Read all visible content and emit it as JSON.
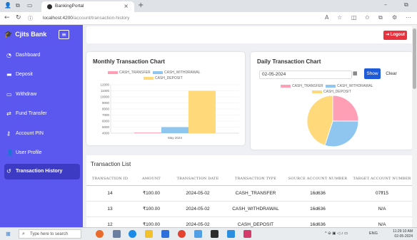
{
  "browser": {
    "tab_title": "BankingPortal",
    "url_host": "localhost:4200",
    "url_path": "/account/transaction-history"
  },
  "sidebar": {
    "brand": "Cjits Bank",
    "items": [
      {
        "label": "Dashboard",
        "icon": "speedometer-icon"
      },
      {
        "label": "Deposit",
        "icon": "cash-icon"
      },
      {
        "label": "Withdraw",
        "icon": "money-icon"
      },
      {
        "label": "Fund Transfer",
        "icon": "transfer-icon"
      },
      {
        "label": "Account PIN",
        "icon": "key-icon"
      },
      {
        "label": "User Profile",
        "icon": "user-icon"
      },
      {
        "label": "Transaction History",
        "icon": "history-icon",
        "active": true
      }
    ]
  },
  "topbar": {
    "logout_label": "Logout"
  },
  "monthly_chart": {
    "title": "Monthly Transaction Chart",
    "legend": [
      "CASH_TRANSFER",
      "CASH_WITHDRAWAL",
      "CASH_DEPOSIT"
    ]
  },
  "daily_chart": {
    "title": "Daily Transaction Chart",
    "date_value": "02-05-2024",
    "show_label": "Show",
    "clear_label": "Clear",
    "legend": [
      "CASH_TRANSFER",
      "CASH_WITHDRAWAL",
      "CASH_DEPOSIT"
    ]
  },
  "colors": {
    "cash_transfer": "#ff9fb5",
    "cash_withdrawal": "#8ec6f0",
    "cash_deposit": "#ffd97a",
    "sidebar": "#5b58ef",
    "logout": "#e8323e",
    "show": "#1e5bd6"
  },
  "chart_data": [
    {
      "type": "bar",
      "categories": [
        "May 2024"
      ],
      "series": [
        {
          "name": "CASH_TRANSFER",
          "values": [
            4100
          ]
        },
        {
          "name": "CASH_WITHDRAWAL",
          "values": [
            5000
          ]
        },
        {
          "name": "CASH_DEPOSIT",
          "values": [
            11000
          ]
        }
      ],
      "title": "Monthly Transaction Chart",
      "yticks": [
        4000,
        5000,
        6000,
        7000,
        8000,
        9000,
        10000,
        11000,
        12000
      ],
      "ylim": [
        4000,
        12000
      ],
      "legend": "top"
    },
    {
      "type": "pie",
      "labels": [
        "CASH_TRANSFER",
        "CASH_WITHDRAWAL",
        "CASH_DEPOSIT"
      ],
      "values": [
        25,
        30,
        45
      ],
      "title": "Daily Transaction Chart",
      "legend": "top"
    }
  ],
  "table": {
    "title": "Transaction List",
    "headers": [
      "Transaction ID",
      "Amount",
      "Transaction Date",
      "Transaction Type",
      "Source Account Number",
      "Target Account Number"
    ],
    "rows": [
      [
        "14",
        "₹100.00",
        "2024-05-02",
        "CASH_TRANSFER",
        "16d636",
        "07ff15"
      ],
      [
        "13",
        "₹100.00",
        "2024-05-02",
        "CASH_WITHDRAWAL",
        "16d636",
        "N/A"
      ],
      [
        "12",
        "₹100.00",
        "2024-05-02",
        "CASH_DEPOSIT",
        "16d636",
        "N/A"
      ]
    ]
  },
  "taskbar": {
    "search_placeholder": "Type here to search",
    "lang": "ENG",
    "time": "11:29:10 AM",
    "date": "02-05-2024"
  }
}
